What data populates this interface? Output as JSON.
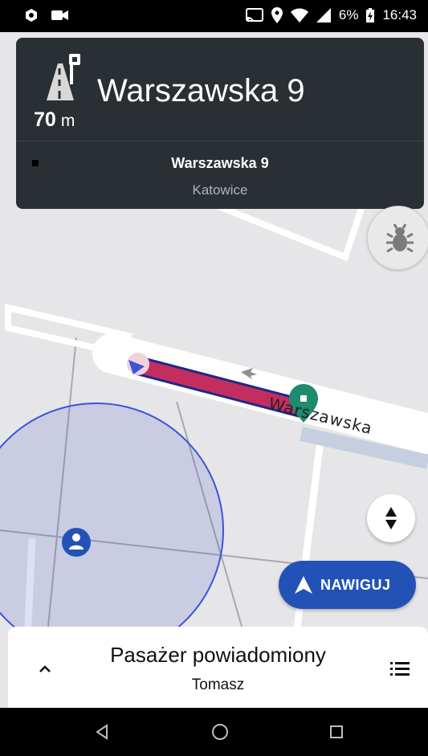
{
  "status_bar": {
    "battery": "6%",
    "time": "16:43"
  },
  "navigation": {
    "distance_value": "70",
    "distance_unit": "m",
    "next_street": "Warszawska 9",
    "destination_street": "Warszawska 9",
    "destination_city": "Katowice"
  },
  "map": {
    "street_label": "Warszawska"
  },
  "buttons": {
    "nawiguj_label": "NAWIGUJ"
  },
  "bottom_sheet": {
    "title": "Pasażer powiadomiony",
    "subtitle": "Tomasz"
  },
  "colors": {
    "accent": "#2352b7",
    "route": "#c42e5e",
    "destination_pin": "#1e8a6e",
    "card_bg": "#2a2f34"
  }
}
